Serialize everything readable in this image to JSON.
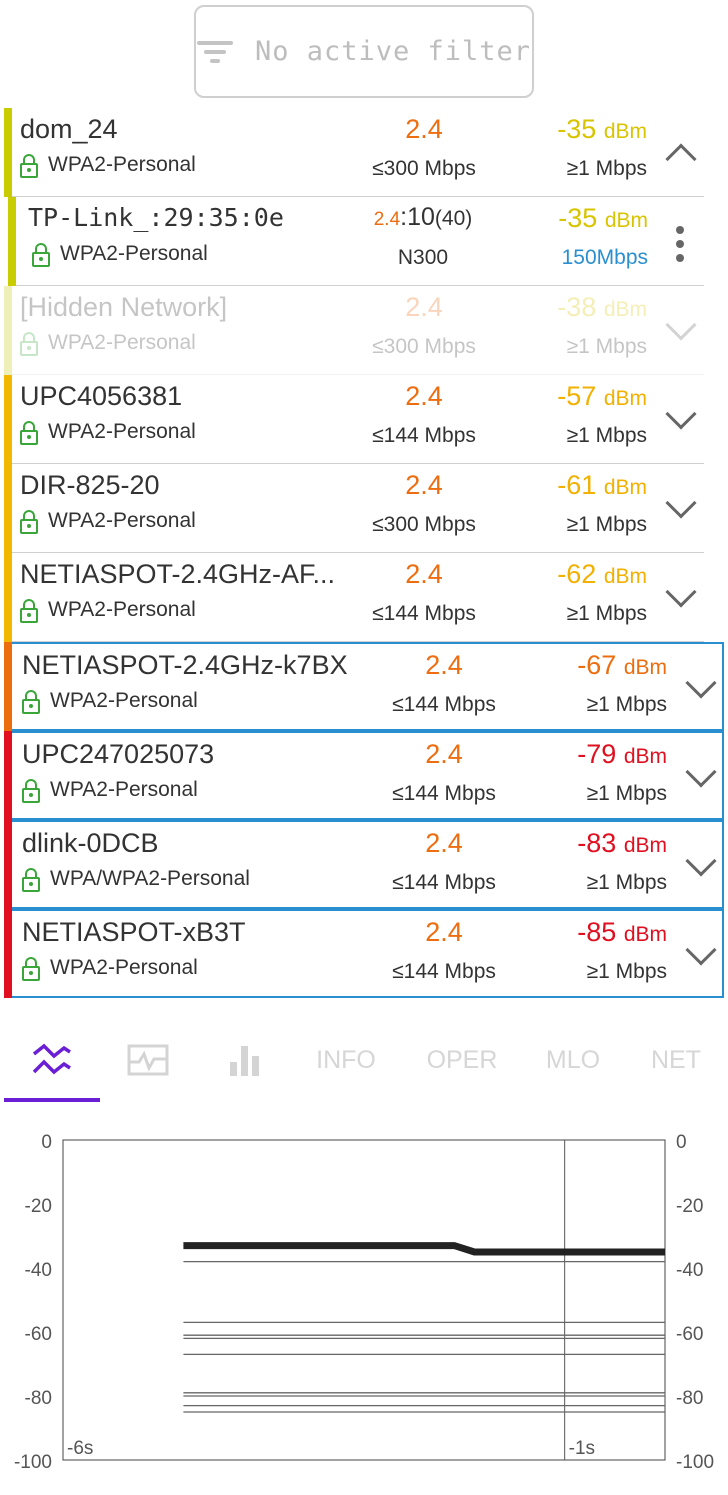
{
  "filter": {
    "label": "No active filter",
    "icon": "filter-icon"
  },
  "networks": [
    {
      "ssid": "dom_24",
      "security": "WPA2-Personal",
      "band": "2.4",
      "max_rate": "≤300 Mbps",
      "signal": "-35",
      "signal_unit": "dBm",
      "min_rate": "≥1 Mbps",
      "color": "#c8cc00",
      "signal_color": "#d8c400",
      "state": "expanded"
    },
    {
      "ssid": "TP-Link_:29:35:0e",
      "security": "WPA2-Personal",
      "band": "2.4",
      "channel": ":10",
      "width": "(40)",
      "standard": "N300",
      "signal": "-35",
      "signal_unit": "dBm",
      "rate": "150Mbps",
      "color": "#c8cc00",
      "signal_color": "#d8c400",
      "rate_color": "#2a8fd0",
      "state": "child"
    },
    {
      "ssid": "[Hidden Network]",
      "security": "WPA2-Personal",
      "band": "2.4",
      "max_rate": "≤300 Mbps",
      "signal": "-38",
      "signal_unit": "dBm",
      "min_rate": "≥1 Mbps",
      "color": "#c8cc00",
      "signal_color": "#d8c400",
      "state": "faded"
    },
    {
      "ssid": "UPC4056381",
      "security": "WPA2-Personal",
      "band": "2.4",
      "max_rate": "≤144 Mbps",
      "signal": "-57",
      "signal_unit": "dBm",
      "min_rate": "≥1 Mbps",
      "color": "#f2b800",
      "signal_color": "#f2b000",
      "state": "normal"
    },
    {
      "ssid": "DIR-825-20",
      "security": "WPA2-Personal",
      "band": "2.4",
      "max_rate": "≤300 Mbps",
      "signal": "-61",
      "signal_unit": "dBm",
      "min_rate": "≥1 Mbps",
      "color": "#f2b800",
      "signal_color": "#f2b000",
      "state": "normal"
    },
    {
      "ssid": "NETIASPOT-2.4GHz-AF...",
      "security": "WPA2-Personal",
      "band": "2.4",
      "max_rate": "≤144 Mbps",
      "signal": "-62",
      "signal_unit": "dBm",
      "min_rate": "≥1 Mbps",
      "color": "#f2b800",
      "signal_color": "#f2b000",
      "state": "normal"
    },
    {
      "ssid": "NETIASPOT-2.4GHz-k7BX",
      "security": "WPA2-Personal",
      "band": "2.4",
      "max_rate": "≤144 Mbps",
      "signal": "-67",
      "signal_unit": "dBm",
      "min_rate": "≥1 Mbps",
      "color": "#ec6d10",
      "signal_color": "#ec6d10",
      "state": "boxed"
    },
    {
      "ssid": "UPC247025073",
      "security": "WPA2-Personal",
      "band": "2.4",
      "max_rate": "≤144 Mbps",
      "signal": "-79",
      "signal_unit": "dBm",
      "min_rate": "≥1 Mbps",
      "color": "#e01020",
      "signal_color": "#e01020",
      "state": "boxed"
    },
    {
      "ssid": "dlink-0DCB",
      "security": "WPA/WPA2-Personal",
      "band": "2.4",
      "max_rate": "≤144 Mbps",
      "signal": "-83",
      "signal_unit": "dBm",
      "min_rate": "≥1 Mbps",
      "color": "#e01020",
      "signal_color": "#e01020",
      "state": "boxed"
    },
    {
      "ssid": "NETIASPOT-xB3T",
      "security": "WPA2-Personal",
      "band": "2.4",
      "max_rate": "≤144 Mbps",
      "signal": "-85",
      "signal_unit": "dBm",
      "min_rate": "≥1 Mbps",
      "color": "#e01020",
      "signal_color": "#e01020",
      "state": "boxed"
    }
  ],
  "tabs": [
    {
      "id": "signal-graph",
      "icon": "signal-graph-icon",
      "active": true
    },
    {
      "id": "signal-monitor",
      "icon": "signal-monitor-icon"
    },
    {
      "id": "bar-chart",
      "icon": "bar-chart-icon"
    },
    {
      "id": "info",
      "label": "INFO"
    },
    {
      "id": "oper",
      "label": "OPER"
    },
    {
      "id": "mlo",
      "label": "MLO"
    },
    {
      "id": "net",
      "label": "NET"
    }
  ],
  "accent_color": "#6a1fd6",
  "chart_data": {
    "type": "line",
    "ylim": [
      -100,
      0
    ],
    "y_ticks": [
      "0",
      "-20",
      "-40",
      "-60",
      "-80",
      "-100"
    ],
    "x_tick_labels": [
      "-6s",
      "-1s"
    ],
    "x_range": [
      -6,
      0
    ],
    "grid": "vertical line at -1s",
    "series": [
      {
        "highlight": true,
        "points": [
          [
            -4.8,
            -33
          ],
          [
            -2.1,
            -33
          ],
          [
            -1.9,
            -35
          ],
          [
            0,
            -35
          ]
        ]
      },
      {
        "points": [
          [
            -4.8,
            -38
          ],
          [
            0,
            -38
          ]
        ]
      },
      {
        "points": [
          [
            -4.8,
            -57
          ],
          [
            0,
            -57
          ]
        ]
      },
      {
        "points": [
          [
            -4.8,
            -61
          ],
          [
            0,
            -61
          ]
        ]
      },
      {
        "points": [
          [
            -4.8,
            -62
          ],
          [
            0,
            -62
          ]
        ]
      },
      {
        "points": [
          [
            -4.8,
            -67
          ],
          [
            0,
            -67
          ]
        ]
      },
      {
        "points": [
          [
            -4.8,
            -79
          ],
          [
            0,
            -79
          ]
        ]
      },
      {
        "points": [
          [
            -4.8,
            -80
          ],
          [
            0,
            -80
          ]
        ]
      },
      {
        "points": [
          [
            -4.8,
            -83
          ],
          [
            0,
            -83
          ]
        ]
      },
      {
        "points": [
          [
            -4.8,
            -85
          ],
          [
            0,
            -85
          ]
        ]
      }
    ]
  }
}
